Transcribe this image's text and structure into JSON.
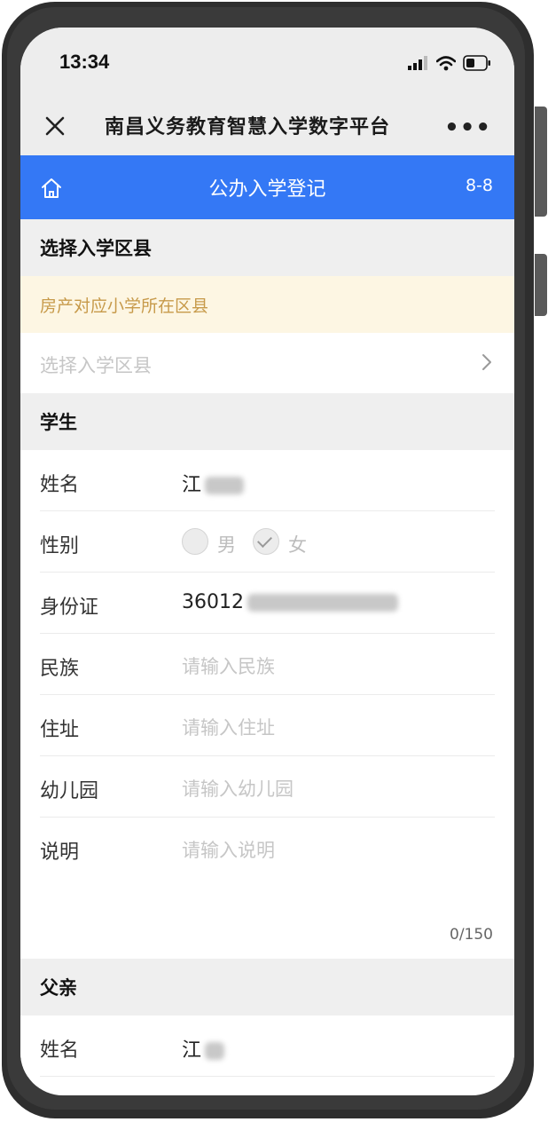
{
  "status_bar": {
    "time": "13:34"
  },
  "app": {
    "title": "南昌义务教育智慧入学数字平台",
    "more": "•••"
  },
  "header": {
    "title": "公办入学登记",
    "page": "8-8"
  },
  "district": {
    "section_title": "选择入学区县",
    "tip": "房产对应小学所在区县",
    "placeholder": "选择入学区县"
  },
  "student": {
    "section_title": "学生",
    "name_label": "姓名",
    "name_value": "江",
    "gender_label": "性别",
    "gender_options": [
      "男",
      "女"
    ],
    "gender_selected": "女",
    "id_label": "身份证",
    "id_value": "36012",
    "ethnicity_label": "民族",
    "ethnicity_placeholder": "请输入民族",
    "address_label": "住址",
    "address_placeholder": "请输入住址",
    "kindergarten_label": "幼儿园",
    "kindergarten_placeholder": "请输入幼儿园",
    "note_label": "说明",
    "note_placeholder": "请输入说明",
    "note_counter": "0/150"
  },
  "father": {
    "section_title": "父亲",
    "name_label": "姓名",
    "name_value": "江"
  },
  "colors": {
    "accent": "#3478f5",
    "tip_bg": "#fdf6e3",
    "tip_text": "#c79a4a"
  }
}
